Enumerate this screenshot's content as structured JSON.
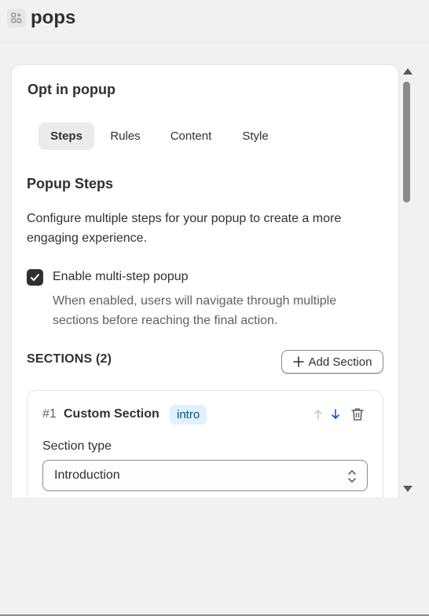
{
  "app": {
    "title": "pops",
    "icon": "app-grid-plus-icon"
  },
  "card": {
    "title": "Opt in popup"
  },
  "tabs": [
    {
      "label": "Steps",
      "active": true
    },
    {
      "label": "Rules",
      "active": false
    },
    {
      "label": "Content",
      "active": false
    },
    {
      "label": "Style",
      "active": false
    }
  ],
  "steps_panel": {
    "heading": "Popup Steps",
    "description": "Configure multiple steps for your popup to create a more engaging experience.",
    "multi_step": {
      "label": "Enable multi-step popup",
      "checked": true,
      "help": "When enabled, users will navigate through multiple sections before reaching the final action."
    },
    "sections_label": "SECTIONS (2)",
    "add_section_label": "Add Section"
  },
  "sections": [
    {
      "number": "#1",
      "name": "Custom Section",
      "badge": "intro",
      "type_label": "Section type",
      "type_value": "Introduction"
    }
  ],
  "colors": {
    "badge_bg": "#e0f0ff",
    "badge_text": "#00527c",
    "move_down_active": "#005bd3",
    "checkbox": "#303030"
  }
}
